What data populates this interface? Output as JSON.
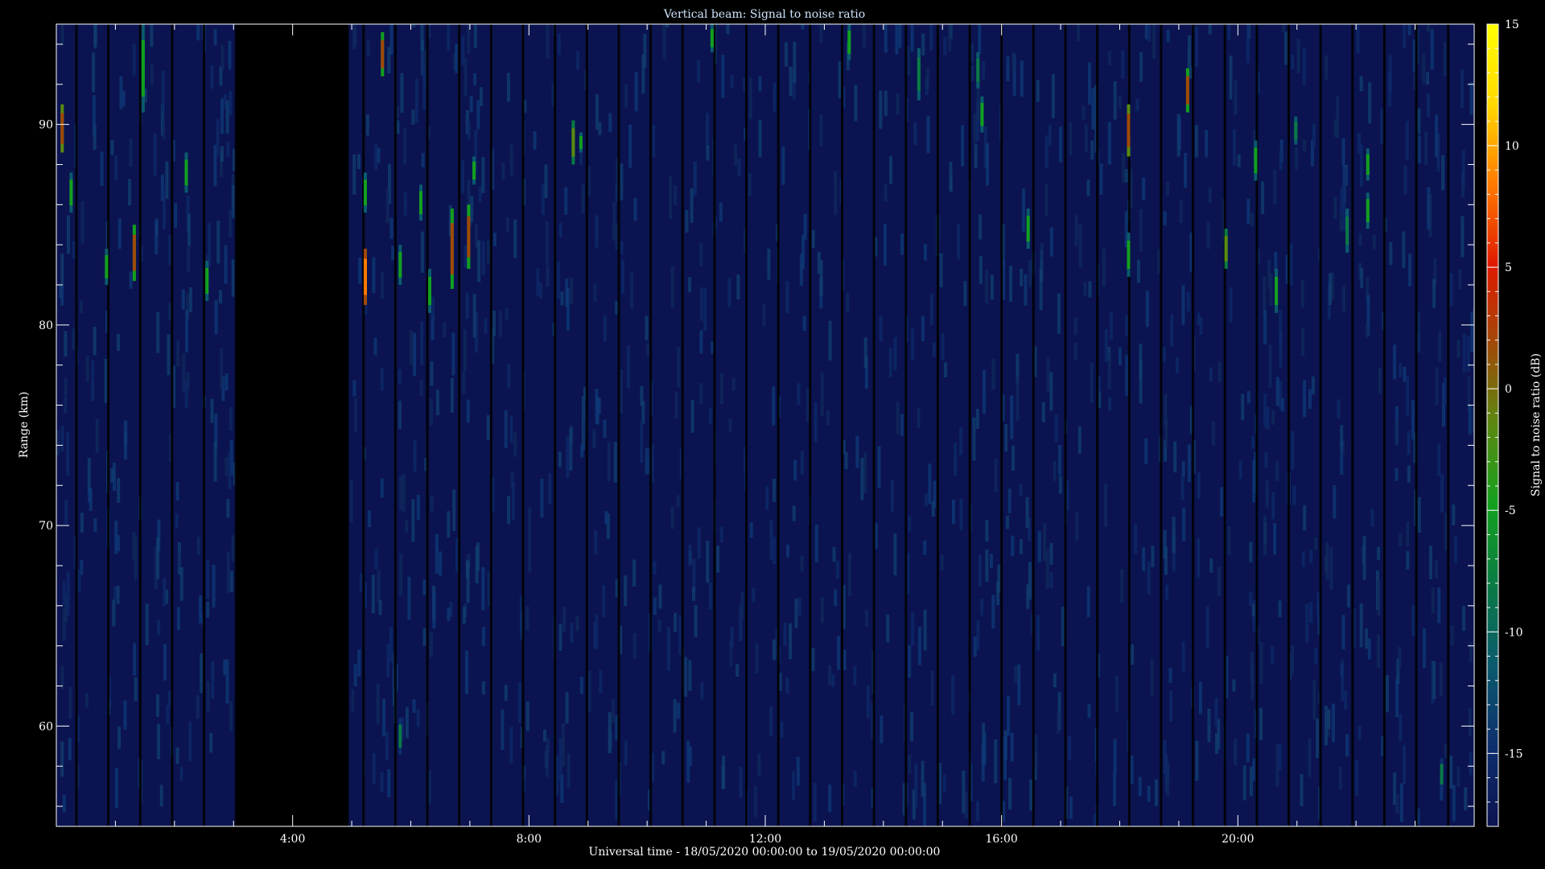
{
  "chart_data": {
    "type": "heatmap",
    "title": "Vertical beam: Signal to noise ratio",
    "xlabel": "Universal time - 18/05/2020 00:00:00 to 19/05/2020 00:00:00",
    "ylabel": "Range (km)",
    "colorbar_label": "Signal to noise ratio (dB)",
    "x_range_hours": [
      0,
      24
    ],
    "y_range_km": [
      55,
      95
    ],
    "x_ticks": [
      {
        "value": 4,
        "label": "4:00"
      },
      {
        "value": 8,
        "label": "8:00"
      },
      {
        "value": 12,
        "label": "12:00"
      },
      {
        "value": 16,
        "label": "16:00"
      },
      {
        "value": 20,
        "label": "20:00"
      }
    ],
    "y_ticks": [
      {
        "value": 60,
        "label": "60"
      },
      {
        "value": 70,
        "label": "70"
      },
      {
        "value": 80,
        "label": "80"
      },
      {
        "value": 90,
        "label": "90"
      }
    ],
    "colorbar_range_db": [
      -18,
      15
    ],
    "colorbar_ticks": [
      {
        "value": 15,
        "label": "15"
      },
      {
        "value": 10,
        "label": "10"
      },
      {
        "value": 5,
        "label": "5"
      },
      {
        "value": 0,
        "label": "0"
      },
      {
        "value": -5,
        "label": "-5"
      },
      {
        "value": -10,
        "label": "-10"
      },
      {
        "value": -15,
        "label": "-15"
      }
    ],
    "colormap": [
      "#0b1450",
      "#0e2f6e",
      "#0b5a6e",
      "#0a7a45",
      "#13a01f",
      "#5a8a10",
      "#a04a08",
      "#e01a00",
      "#ff7a00",
      "#ffd800",
      "#ffff00"
    ],
    "background_color": "#0b1450",
    "data_gap_hours": [
      3.05,
      4.95
    ],
    "echoes": [
      {
        "t": 0.1,
        "r0": 88.6,
        "r1": 91.0,
        "snr": 3
      },
      {
        "t": 0.25,
        "r0": 85.6,
        "r1": 87.6,
        "snr": -6
      },
      {
        "t": 0.85,
        "r0": 82.0,
        "r1": 83.8,
        "snr": -6
      },
      {
        "t": 1.32,
        "r0": 82.2,
        "r1": 85.0,
        "snr": 2
      },
      {
        "t": 1.47,
        "r0": 90.6,
        "r1": 95.0,
        "snr": -6
      },
      {
        "t": 2.2,
        "r0": 86.6,
        "r1": 88.6,
        "snr": -6
      },
      {
        "t": 2.55,
        "r0": 81.2,
        "r1": 83.2,
        "snr": -5
      },
      {
        "t": 5.23,
        "r0": 85.6,
        "r1": 87.6,
        "snr": -6
      },
      {
        "t": 5.23,
        "r0": 81.0,
        "r1": 83.8,
        "snr": 8
      },
      {
        "t": 5.52,
        "r0": 92.4,
        "r1": 94.6,
        "snr": 2
      },
      {
        "t": 5.82,
        "r0": 82.0,
        "r1": 84.0,
        "snr": -6
      },
      {
        "t": 6.17,
        "r0": 85.2,
        "r1": 87.0,
        "snr": -6
      },
      {
        "t": 6.32,
        "r0": 80.6,
        "r1": 82.8,
        "snr": -5
      },
      {
        "t": 6.7,
        "r0": 81.8,
        "r1": 85.8,
        "snr": 1
      },
      {
        "t": 6.98,
        "r0": 82.8,
        "r1": 86.0,
        "snr": 1
      },
      {
        "t": 7.07,
        "r0": 87.0,
        "r1": 88.4,
        "snr": -6
      },
      {
        "t": 8.75,
        "r0": 88.0,
        "r1": 90.2,
        "snr": -3
      },
      {
        "t": 8.88,
        "r0": 88.6,
        "r1": 89.6,
        "snr": -6
      },
      {
        "t": 11.1,
        "r0": 93.6,
        "r1": 95.0,
        "snr": -6
      },
      {
        "t": 13.42,
        "r0": 93.2,
        "r1": 95.0,
        "snr": -6
      },
      {
        "t": 14.6,
        "r0": 91.2,
        "r1": 93.8,
        "snr": -7
      },
      {
        "t": 15.6,
        "r0": 91.8,
        "r1": 93.6,
        "snr": -7
      },
      {
        "t": 15.67,
        "r0": 89.6,
        "r1": 91.4,
        "snr": -6
      },
      {
        "t": 16.45,
        "r0": 83.8,
        "r1": 85.8,
        "snr": -6
      },
      {
        "t": 18.15,
        "r0": 88.4,
        "r1": 91.0,
        "snr": 3
      },
      {
        "t": 18.15,
        "r0": 82.4,
        "r1": 84.6,
        "snr": -5
      },
      {
        "t": 19.15,
        "r0": 90.6,
        "r1": 92.8,
        "snr": 1
      },
      {
        "t": 19.8,
        "r0": 82.8,
        "r1": 84.8,
        "snr": -1
      },
      {
        "t": 20.3,
        "r0": 87.2,
        "r1": 89.2,
        "snr": -6
      },
      {
        "t": 20.65,
        "r0": 80.6,
        "r1": 82.8,
        "snr": -5
      },
      {
        "t": 20.98,
        "r0": 89.0,
        "r1": 90.4,
        "snr": -7
      },
      {
        "t": 21.85,
        "r0": 83.6,
        "r1": 85.8,
        "snr": -7
      },
      {
        "t": 22.2,
        "r0": 84.8,
        "r1": 86.6,
        "snr": -6
      },
      {
        "t": 22.2,
        "r0": 87.2,
        "r1": 88.8,
        "snr": -6
      },
      {
        "t": 23.45,
        "r0": 56.8,
        "r1": 58.4,
        "snr": -9
      },
      {
        "t": 5.82,
        "r0": 58.6,
        "r1": 60.4,
        "snr": -8
      }
    ]
  }
}
